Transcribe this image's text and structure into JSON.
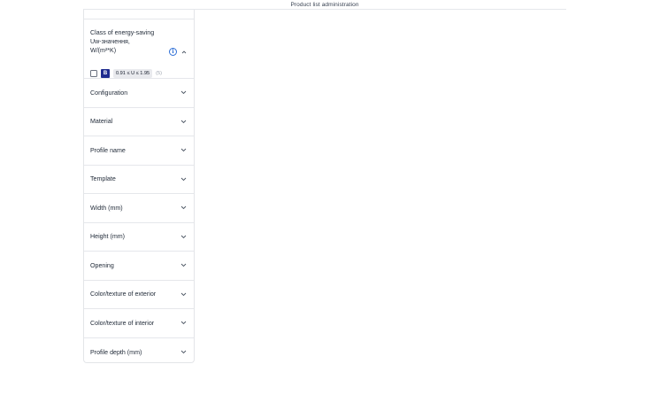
{
  "header": {
    "title": "Product list administration"
  },
  "energy_filter": {
    "title_line1": "Class of energy-saving",
    "title_line2": "Uw-значення,",
    "title_line3": "W/(m²*K)",
    "info_icon": "info-icon",
    "class_badge": "B",
    "range": "0.91 ≤ U ≤ 1.95",
    "count": "(5)",
    "checked": false
  },
  "accordion": [
    {
      "label": "Configuration"
    },
    {
      "label": "Material"
    },
    {
      "label": "Profile name"
    },
    {
      "label": "Template"
    },
    {
      "label": "Width (mm)"
    },
    {
      "label": "Height (mm)"
    },
    {
      "label": "Opening"
    },
    {
      "label": "Color/texture of exterior"
    },
    {
      "label": "Color/texture of interior"
    },
    {
      "label": "Profile depth (mm)"
    }
  ],
  "colors": {
    "badge": "#1e2b8f",
    "info": "#2f6fd6",
    "border": "#e5e7eb"
  }
}
